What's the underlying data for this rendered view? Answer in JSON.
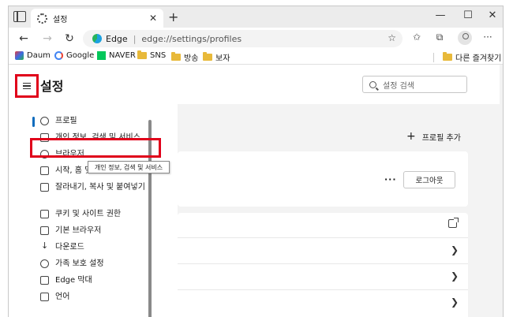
{
  "tab": {
    "title": "설정"
  },
  "address": {
    "label": "Edge",
    "url": "edge://settings/profiles"
  },
  "bookmarks": [
    {
      "label": "Daum"
    },
    {
      "label": "Google"
    },
    {
      "label": "NAVER"
    },
    {
      "label": "SNS"
    },
    {
      "label": "방송"
    },
    {
      "label": "보자"
    }
  ],
  "other_favorites": "다른 즐겨찾기",
  "settings": {
    "title": "설정",
    "search_placeholder": "설정 검색"
  },
  "nav": [
    {
      "label": "프로필",
      "active": true
    },
    {
      "label": "개인 정보, 검색 및 서비스"
    },
    {
      "label": "브라우저"
    },
    {
      "label": "시작, 홈 및 새 탭"
    },
    {
      "label": "잘라내기, 복사 및 붙여넣기"
    },
    {
      "label": "쿠키 및 사이트 권한"
    },
    {
      "label": "기본 브라우저"
    },
    {
      "label": "다운로드"
    },
    {
      "label": "가족 보호 설정"
    },
    {
      "label": "Edge 막대"
    },
    {
      "label": "언어"
    }
  ],
  "tooltip": "개인 정보, 검색 및 서비스",
  "profile": {
    "add_label": "프로필 추가",
    "logout_label": "로그아웃",
    "more_label": "···"
  },
  "colors": {
    "highlight": "#e0001a",
    "accent": "#0f6cbd"
  }
}
